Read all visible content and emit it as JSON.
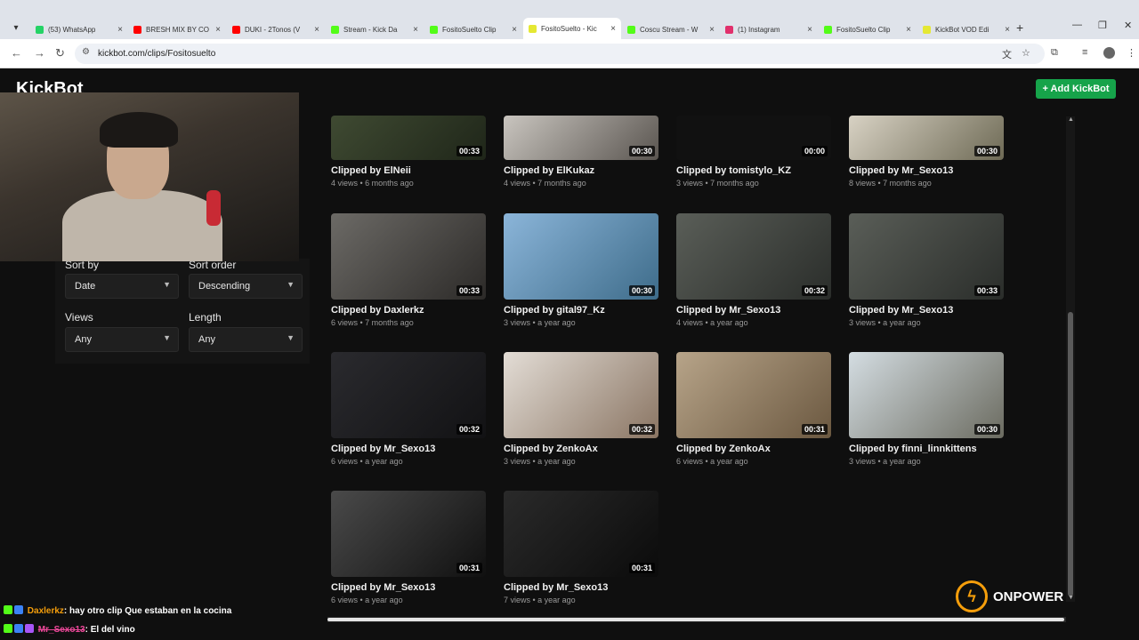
{
  "browser": {
    "tabs": [
      {
        "title": "(53) WhatsApp",
        "color": "#25d366",
        "active": false
      },
      {
        "title": "BRESH MIX BY CO",
        "color": "#ff0000",
        "active": false
      },
      {
        "title": "DUKI - 2Tonos (V",
        "color": "#ff0000",
        "active": false
      },
      {
        "title": "Stream - Kick Da",
        "color": "#53fc18",
        "active": false
      },
      {
        "title": "FositoSuelto Clip",
        "color": "#53fc18",
        "active": false
      },
      {
        "title": "FositoSuelto - Kic",
        "color": "#e5e833",
        "active": true
      },
      {
        "title": "Coscu Stream - W",
        "color": "#53fc18",
        "active": false
      },
      {
        "title": "(1) Instagram",
        "color": "#e1306c",
        "active": false
      },
      {
        "title": "FositoSuelto Clip",
        "color": "#53fc18",
        "active": false
      },
      {
        "title": "KickBot VOD Edi",
        "color": "#e5e833",
        "active": false
      }
    ],
    "url": "kickbot.com/clips/Fositosuelto"
  },
  "header": {
    "logo": "KickBot",
    "add_button": "+ Add KickBot"
  },
  "filters": {
    "sort_by_label": "Sort by",
    "sort_by_value": "Date",
    "sort_order_label": "Sort order",
    "sort_order_value": "Descending",
    "views_label": "Views",
    "views_value": "Any",
    "length_label": "Length",
    "length_value": "Any"
  },
  "clips": [
    {
      "title": "Clipped by ElNeii",
      "meta": "4 views • 6 months ago",
      "duration": "00:33"
    },
    {
      "title": "Clipped by ElKukaz",
      "meta": "4 views • 7 months ago",
      "duration": "00:30"
    },
    {
      "title": "Clipped by tomistylo_KZ",
      "meta": "3 views • 7 months ago",
      "duration": "00:00"
    },
    {
      "title": "Clipped by Mr_Sexo13",
      "meta": "8 views • 7 months ago",
      "duration": "00:30"
    },
    {
      "title": "Clipped by Daxlerkz",
      "meta": "6 views • 7 months ago",
      "duration": "00:33"
    },
    {
      "title": "Clipped by gital97_Kz",
      "meta": "3 views • a year ago",
      "duration": "00:30"
    },
    {
      "title": "Clipped by Mr_Sexo13",
      "meta": "4 views • a year ago",
      "duration": "00:32"
    },
    {
      "title": "Clipped by Mr_Sexo13",
      "meta": "3 views • a year ago",
      "duration": "00:33"
    },
    {
      "title": "Clipped by Mr_Sexo13",
      "meta": "6 views • a year ago",
      "duration": "00:32"
    },
    {
      "title": "Clipped by ZenkoAx",
      "meta": "3 views • a year ago",
      "duration": "00:32"
    },
    {
      "title": "Clipped by ZenkoAx",
      "meta": "6 views • a year ago",
      "duration": "00:31"
    },
    {
      "title": "Clipped by finni_linnkittens",
      "meta": "3 views • a year ago",
      "duration": "00:30"
    },
    {
      "title": "Clipped by Mr_Sexo13",
      "meta": "6 views • a year ago",
      "duration": "00:31"
    },
    {
      "title": "Clipped by Mr_Sexo13",
      "meta": "7 views • a year ago",
      "duration": "00:31"
    }
  ],
  "overlay": {
    "brand": "ONPOWER",
    "chat": [
      {
        "user": "Daxlerkz",
        "message": ": hay otro clip Que estaban en la cocina"
      },
      {
        "user": "Mr_Sexo13",
        "message": ": El del vino"
      }
    ]
  },
  "colors": {
    "accent": "#16a34a",
    "background": "#0f0f0f"
  }
}
